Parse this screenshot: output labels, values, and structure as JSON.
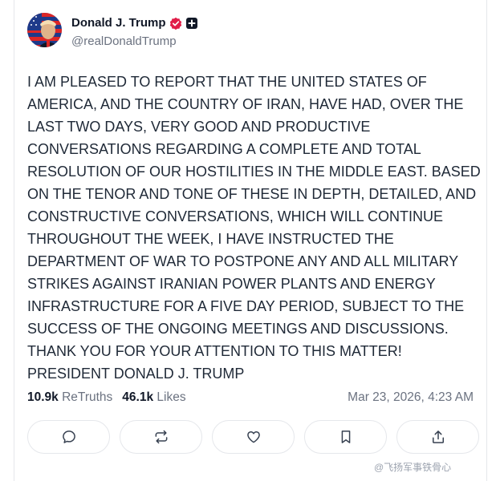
{
  "author": {
    "display_name": "Donald J. Trump",
    "handle": "@realDonaldTrump",
    "avatar_icon": "avatar-flag-portrait",
    "verified_icon": "verified-badge-icon",
    "verified_color": "#e11d48",
    "extra_badge_icon": "plus-badge-icon"
  },
  "post": {
    "text": "I AM PLEASED TO REPORT THAT THE UNITED STATES OF\nAMERICA, AND THE COUNTRY OF IRAN, HAVE HAD, OVER THE\nLAST TWO DAYS, VERY GOOD AND PRODUCTIVE\nCONVERSATIONS REGARDING A COMPLETE AND TOTAL\nRESOLUTION OF OUR HOSTILITIES IN THE MIDDLE EAST. BASED\nON THE TENOR AND TONE OF THESE IN DEPTH, DETAILED, AND\nCONSTRUCTIVE CONVERSATIONS, WHICH WILL CONTINUE\nTHROUGHOUT THE WEEK, I HAVE INSTRUCTED THE\nDEPARTMENT OF WAR TO POSTPONE ANY AND ALL MILITARY\nSTRIKES AGAINST IRANIAN POWER PLANTS AND ENERGY\nINFRASTRUCTURE FOR A FIVE DAY PERIOD, SUBJECT TO THE\nSUCCESS OF THE ONGOING MEETINGS AND DISCUSSIONS.\nTHANK YOU FOR YOUR ATTENTION TO THIS MATTER!\nPRESIDENT DONALD J. TRUMP"
  },
  "stats": {
    "retruths_count": "10.9k",
    "retruths_label": "ReTruths",
    "likes_count": "46.1k",
    "likes_label": "Likes",
    "timestamp": "Mar 23, 2026, 4:23 AM"
  },
  "actions": [
    {
      "icon": "comment-icon"
    },
    {
      "icon": "retruth-icon"
    },
    {
      "icon": "heart-icon"
    },
    {
      "icon": "bookmark-icon"
    },
    {
      "icon": "share-icon"
    }
  ],
  "watermark": {
    "text": "@飞扬军事铁骨心"
  }
}
